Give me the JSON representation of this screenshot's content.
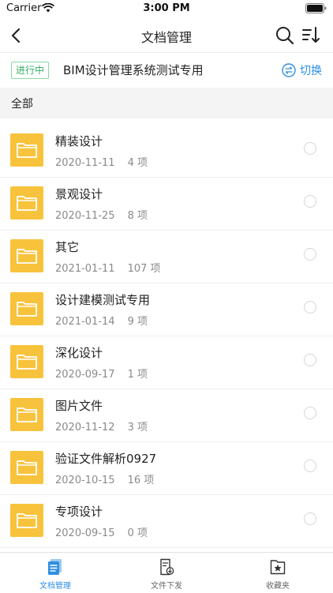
{
  "status_bar": {
    "carrier": "Carrier",
    "time": "3:00 PM"
  },
  "nav": {
    "title": "文档管理"
  },
  "project": {
    "status_tag": "进行中",
    "name": "BIM设计管理系统测试专用",
    "switch_label": "切换"
  },
  "filter": {
    "label": "全部"
  },
  "folders": [
    {
      "name": "精装设计",
      "date": "2020-11-11",
      "count": "4 项"
    },
    {
      "name": "景观设计",
      "date": "2020-11-25",
      "count": "8 项"
    },
    {
      "name": "其它",
      "date": "2021-01-11",
      "count": "107 项"
    },
    {
      "name": "设计建模测试专用",
      "date": "2021-01-14",
      "count": "9 项"
    },
    {
      "name": "深化设计",
      "date": "2020-09-17",
      "count": "1 项"
    },
    {
      "name": "图片文件",
      "date": "2020-11-12",
      "count": "3 项"
    },
    {
      "name": "验证文件解析0927",
      "date": "2020-10-15",
      "count": "16 项"
    },
    {
      "name": "专项设计",
      "date": "2020-09-15",
      "count": "0 项"
    }
  ],
  "tabs": [
    {
      "label": "文档管理",
      "icon": "document-list-icon",
      "active": true
    },
    {
      "label": "文件下发",
      "icon": "file-download-icon",
      "active": false
    },
    {
      "label": "收藏夹",
      "icon": "favorites-star-icon",
      "active": false
    }
  ],
  "colors": {
    "accent": "#2f8fe0",
    "folder": "#f8c33c",
    "status_tag_green": "#35b064",
    "filter_background": "#f4f4f4"
  }
}
